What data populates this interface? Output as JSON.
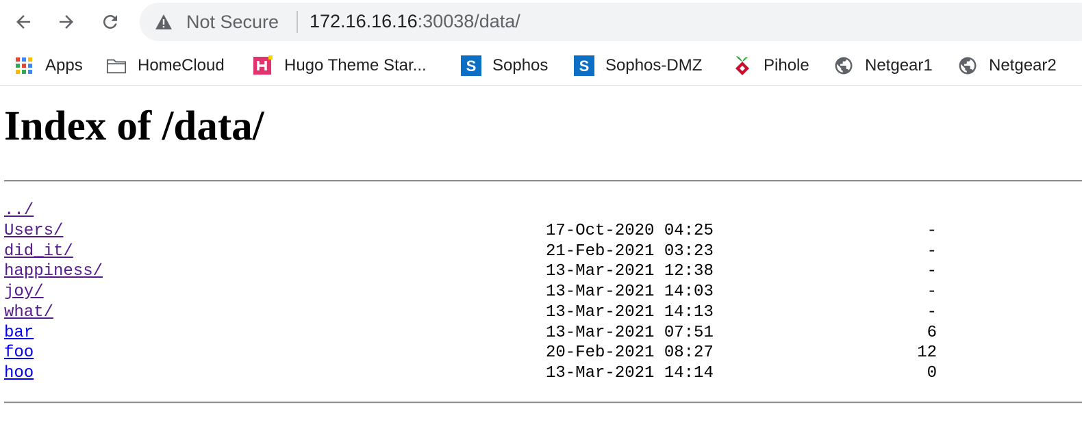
{
  "browser": {
    "security_text": "Not Secure",
    "url_host": "172.16.16.16",
    "url_path": ":30038/data/"
  },
  "bookmarks": [
    {
      "label": "Apps",
      "icon": "apps-grid-icon"
    },
    {
      "label": "HomeCloud",
      "icon": "folder-icon"
    },
    {
      "label": "Hugo Theme Star...",
      "icon": "hugo-icon"
    },
    {
      "label": "Sophos",
      "icon": "sophos-icon"
    },
    {
      "label": "Sophos-DMZ",
      "icon": "sophos-icon"
    },
    {
      "label": "Pihole",
      "icon": "pihole-icon"
    },
    {
      "label": "Netgear1",
      "icon": "globe-icon"
    },
    {
      "label": "Netgear2",
      "icon": "globe-icon"
    }
  ],
  "page": {
    "title": "Index of /data/"
  },
  "listing": {
    "parent": "../",
    "entries": [
      {
        "name": "Users/",
        "date": "17-Oct-2020 04:25",
        "size": "-",
        "is_dir": true
      },
      {
        "name": "did_it/",
        "date": "21-Feb-2021 03:23",
        "size": "-",
        "is_dir": true
      },
      {
        "name": "happiness/",
        "date": "13-Mar-2021 12:38",
        "size": "-",
        "is_dir": true
      },
      {
        "name": "joy/",
        "date": "13-Mar-2021 14:03",
        "size": "-",
        "is_dir": true
      },
      {
        "name": "what/",
        "date": "13-Mar-2021 14:13",
        "size": "-",
        "is_dir": true
      },
      {
        "name": "bar",
        "date": "13-Mar-2021 07:51",
        "size": "6",
        "is_dir": false
      },
      {
        "name": "foo",
        "date": "20-Feb-2021 08:27",
        "size": "12",
        "is_dir": false
      },
      {
        "name": "hoo",
        "date": "13-Mar-2021 14:14",
        "size": "0",
        "is_dir": false
      }
    ]
  },
  "colors": {
    "visited_link": "#551a8b",
    "link": "#0000ee",
    "sophos_blue": "#0b6fc6",
    "hugo_pink": "#e2336f"
  }
}
